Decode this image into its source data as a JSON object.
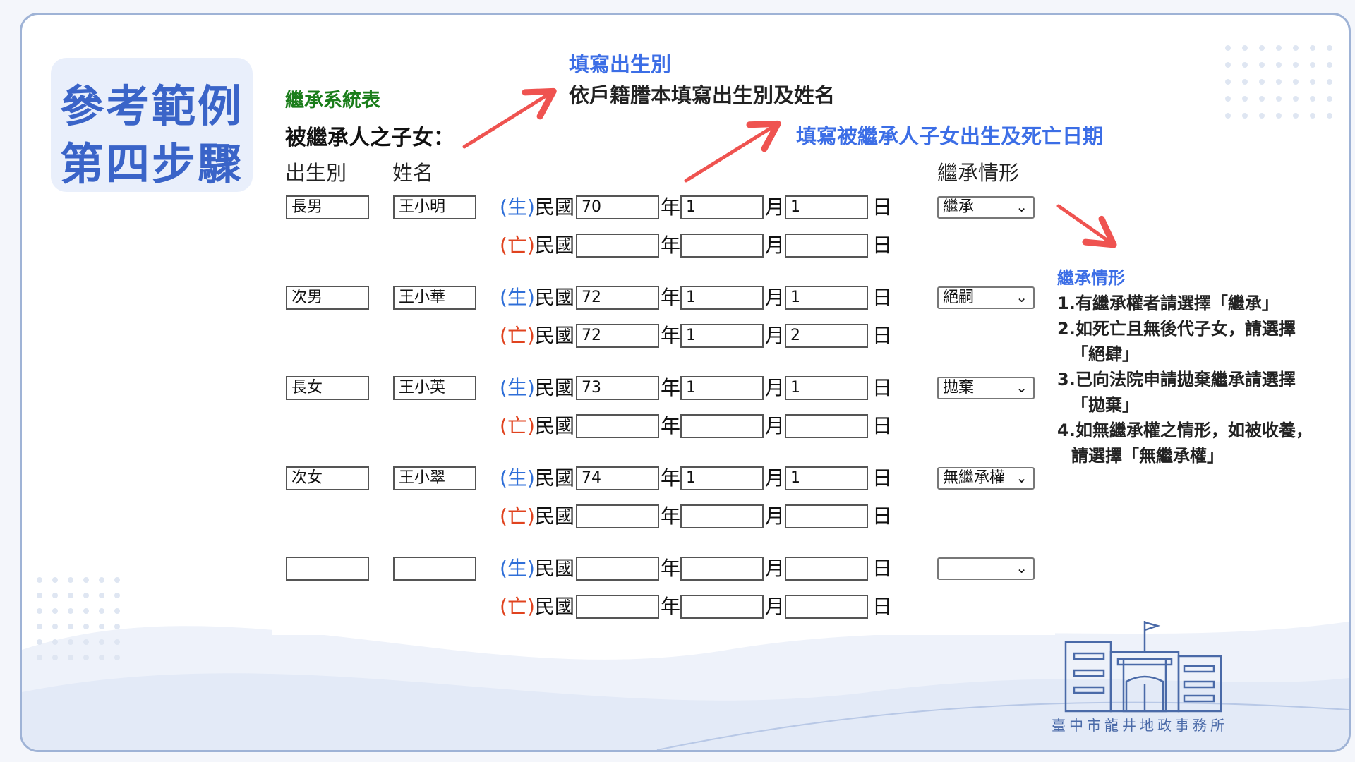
{
  "page": {
    "title_line1": "參考範例",
    "title_line2": "第四步驟"
  },
  "form": {
    "table_title": "繼承系統表",
    "subtitle": "被繼承人之子女：",
    "col_birth_order": "出生別",
    "col_name": "姓名",
    "col_status": "繼承情形",
    "birth_prefix": "生",
    "death_prefix": "亡",
    "era_label": "民國",
    "year_unit": "年",
    "month_unit": "月",
    "day_unit": "日",
    "rows": [
      {
        "order": "長男",
        "name": "王小明",
        "status": "繼承",
        "birth": {
          "y": "70",
          "m": "1",
          "d": "1"
        },
        "death": {
          "y": "",
          "m": "",
          "d": ""
        }
      },
      {
        "order": "次男",
        "name": "王小華",
        "status": "絕嗣",
        "birth": {
          "y": "72",
          "m": "1",
          "d": "1"
        },
        "death": {
          "y": "72",
          "m": "1",
          "d": "2"
        }
      },
      {
        "order": "長女",
        "name": "王小英",
        "status": "拋棄",
        "birth": {
          "y": "73",
          "m": "1",
          "d": "1"
        },
        "death": {
          "y": "",
          "m": "",
          "d": ""
        }
      },
      {
        "order": "次女",
        "name": "王小翠",
        "status": "無繼承權",
        "birth": {
          "y": "74",
          "m": "1",
          "d": "1"
        },
        "death": {
          "y": "",
          "m": "",
          "d": ""
        }
      },
      {
        "order": "",
        "name": "",
        "status": "",
        "birth": {
          "y": "",
          "m": "",
          "d": ""
        },
        "death": {
          "y": "",
          "m": "",
          "d": ""
        }
      }
    ]
  },
  "annotations": {
    "birth_order_title": "填寫出生別",
    "birth_order_desc": "依戶籍謄本填寫出生別及姓名",
    "dates_title": "填寫被繼承人子女出生及死亡日期",
    "status_note": {
      "title": "繼承情形",
      "lines": [
        "1.有繼承權者請選擇「繼承」",
        "2.如死亡且無後代子女，請選擇",
        "「絕肆」",
        "3.已向法院申請拋棄繼承請選擇",
        "「拋棄」",
        "4.如無繼承權之情形，如被收養，",
        "請選擇「無繼承權」"
      ]
    }
  },
  "footer": {
    "office_name": "臺中市龍井地政事務所"
  },
  "colors": {
    "accent_blue": "#3c6ee6",
    "arrow_red": "#ef5350",
    "form_green": "#1a7d1a"
  }
}
